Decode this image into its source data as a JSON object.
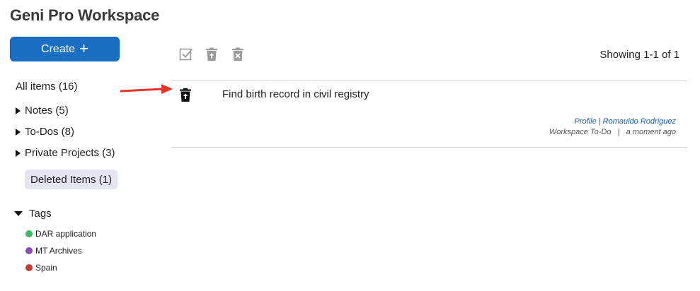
{
  "header": {
    "title": "Geni Pro Workspace"
  },
  "create": {
    "label": "Create",
    "plus": "+"
  },
  "sidebar": {
    "all_items": "All items (16)",
    "groups": [
      {
        "label": "Notes (5)"
      },
      {
        "label": "To-Dos (8)"
      },
      {
        "label": "Private Projects (3)"
      }
    ],
    "deleted": "Deleted Items (1)",
    "tags_label": "Tags",
    "tags": [
      {
        "label": "DAR application",
        "color": "#3cb86b"
      },
      {
        "label": "MT Archives",
        "color": "#8e4bb5"
      },
      {
        "label": "Spain",
        "color": "#c43b32"
      }
    ]
  },
  "toolbar": {
    "icons": [
      "checkbox-icon",
      "restore-trash-icon",
      "delete-forever-icon"
    ],
    "showing": "Showing 1-1 of 1"
  },
  "list": {
    "items": [
      {
        "title": "Find birth record in civil registry",
        "profile_link": "Profile | Romauldo Rodriguez",
        "type": "Workspace To-Do",
        "separator": "|",
        "time": "a moment ago"
      }
    ]
  },
  "annotation": {
    "arrow_color": "#e8322a"
  }
}
